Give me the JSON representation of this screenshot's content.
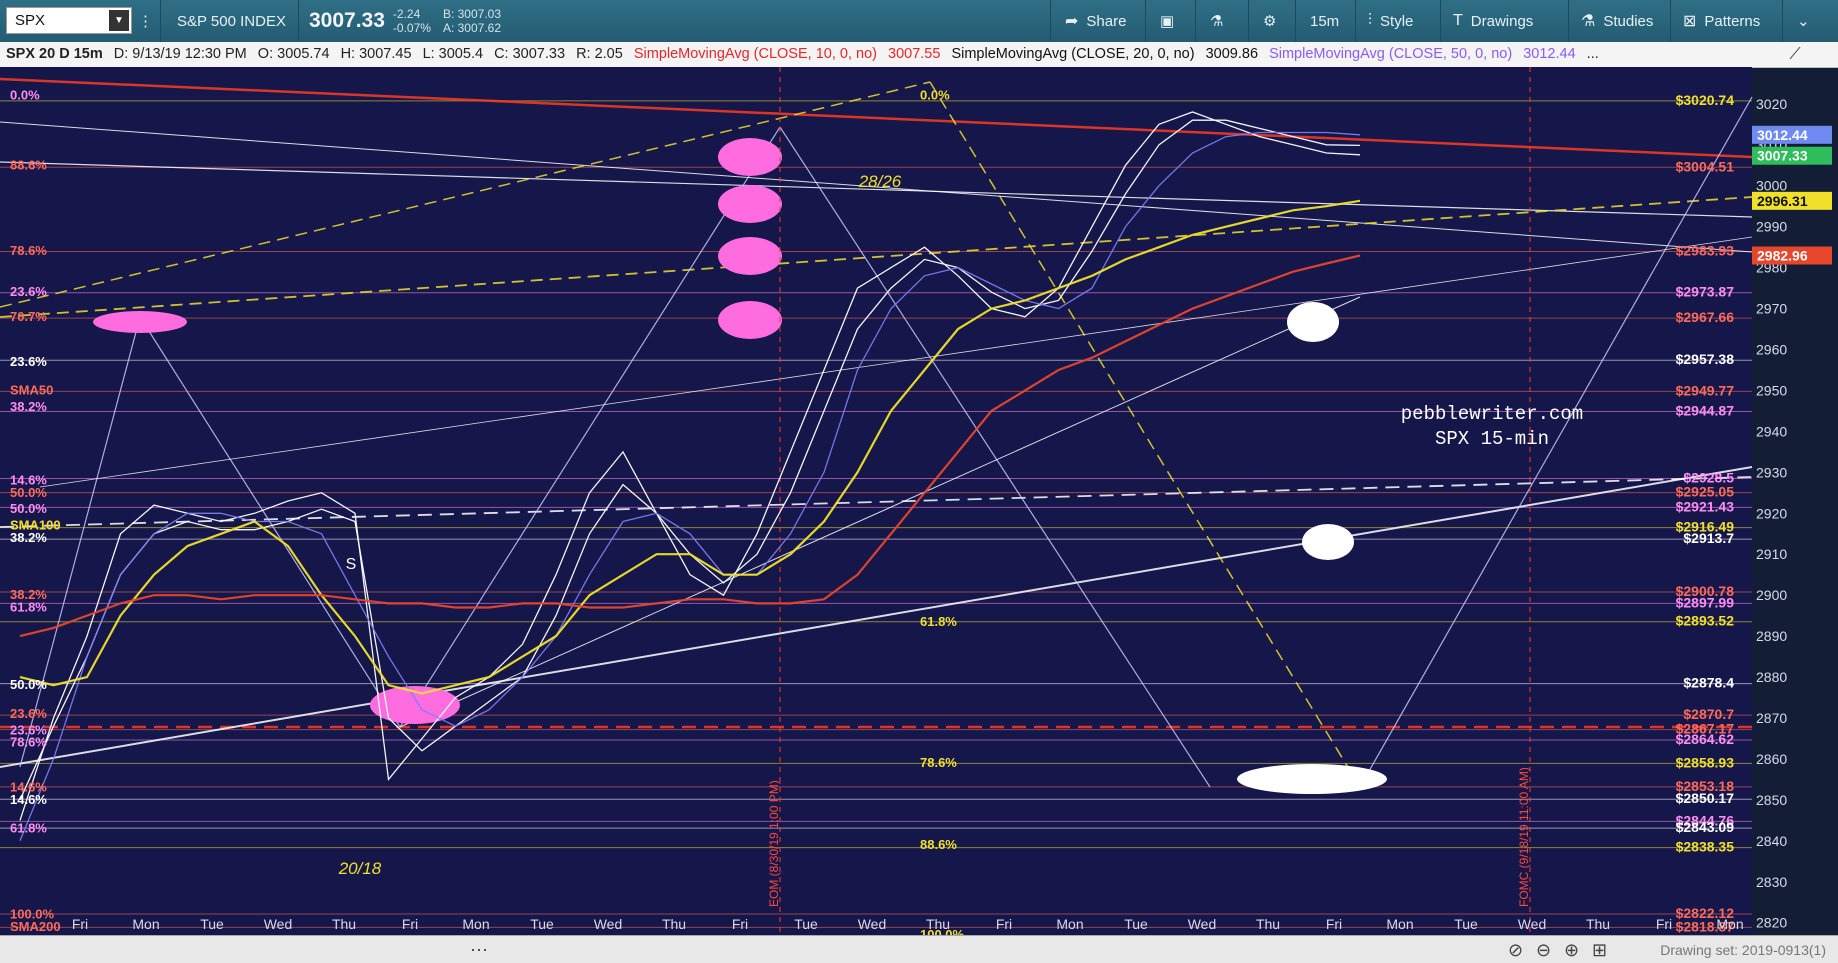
{
  "toolbar": {
    "symbol": "SPX",
    "index_name": "S&P 500 INDEX",
    "price": "3007.33",
    "change": "-2.24",
    "change_pct": "-0.07%",
    "bid": "B: 3007.03",
    "ask": "A: 3007.62",
    "share": "Share",
    "interval": "15m",
    "style": "Style",
    "drawings": "Drawings",
    "studies": "Studies",
    "patterns": "Patterns"
  },
  "infobar": {
    "title": "SPX 20 D 15m",
    "date": "D: 9/13/19 12:30 PM",
    "open": "O: 3005.74",
    "high": "H: 3007.45",
    "low": "L: 3005.4",
    "close": "C: 3007.33",
    "range": "R: 2.05",
    "sma10_label": "SimpleMovingAvg (CLOSE, 10, 0, no)",
    "sma10_value": "3007.55",
    "sma20_label": "SimpleMovingAvg (CLOSE, 20, 0, no)",
    "sma20_value": "3009.86",
    "sma50_label": "SimpleMovingAvg (CLOSE, 50, 0, no)",
    "sma50_value": "3012.44",
    "more": "..."
  },
  "footer": {
    "drawing_set": "Drawing set: 2019-0913(1)"
  },
  "chart_data": {
    "type": "line",
    "title": "SPX 20 D 15m",
    "ylim": [
      2817,
      3029
    ],
    "y_ticks": [
      3020,
      3010,
      3000,
      2990,
      2980,
      2970,
      2960,
      2950,
      2940,
      2930,
      2920,
      2910,
      2900,
      2890,
      2880,
      2870,
      2860,
      2850,
      2840,
      2830,
      2820
    ],
    "x_days": [
      "Fri",
      "Mon",
      "Tue",
      "Wed",
      "Thu",
      "Fri",
      "Mon",
      "Tue",
      "Wed",
      "Thu",
      "Fri",
      "Tue",
      "Wed",
      "Thu",
      "Fri",
      "Mon",
      "Tue",
      "Wed",
      "Thu",
      "Fri",
      "Mon",
      "Tue",
      "Wed",
      "Thu",
      "Fri",
      "Mon"
    ],
    "price_tags": [
      {
        "label": "3012.44",
        "value": 3012.44,
        "color": "#6f8bf2"
      },
      {
        "label": "3007.33",
        "value": 3007.33,
        "color": "#2ebd5a"
      },
      {
        "label": "2996.31",
        "value": 2996.31,
        "color": "#f0e02a"
      },
      {
        "label": "2982.96",
        "value": 2982.96,
        "color": "#e8462a"
      }
    ],
    "series": [
      {
        "name": "SimpleMovingAvg (CLOSE, 10, 0, no)",
        "color": "#ffffff",
        "x": [
          0,
          1,
          2,
          3,
          4,
          5,
          6,
          7,
          8,
          9,
          10,
          11,
          12,
          13,
          14,
          15,
          16,
          17,
          18,
          19,
          20,
          21,
          22,
          23,
          24,
          25,
          26,
          27,
          28,
          29,
          30,
          31,
          32,
          33,
          34,
          35,
          36,
          37,
          38,
          39,
          40
        ],
        "values": [
          2845,
          2870,
          2890,
          2915,
          2922,
          2920,
          2918,
          2920,
          2923,
          2925,
          2920,
          2855,
          2865,
          2875,
          2880,
          2888,
          2905,
          2925,
          2935,
          2920,
          2905,
          2900,
          2915,
          2935,
          2955,
          2975,
          2980,
          2985,
          2978,
          2970,
          2968,
          2975,
          2990,
          3005,
          3015,
          3018,
          3015,
          3012,
          3010,
          3008,
          3007.55
        ]
      },
      {
        "name": "SimpleMovingAvg (CLOSE, 20, 0, no)",
        "color": "#ffffff",
        "x": [
          0,
          1,
          2,
          3,
          4,
          5,
          6,
          7,
          8,
          9,
          10,
          11,
          12,
          13,
          14,
          15,
          16,
          17,
          18,
          19,
          20,
          21,
          22,
          23,
          24,
          25,
          26,
          27,
          28,
          29,
          30,
          31,
          32,
          33,
          34,
          35,
          36,
          37,
          38,
          39,
          40
        ],
        "values": [
          2850,
          2868,
          2885,
          2905,
          2915,
          2918,
          2916,
          2916,
          2918,
          2921,
          2918,
          2870,
          2862,
          2868,
          2874,
          2880,
          2895,
          2915,
          2927,
          2920,
          2910,
          2903,
          2910,
          2925,
          2945,
          2965,
          2975,
          2982,
          2980,
          2974,
          2970,
          2972,
          2984,
          2998,
          3010,
          3016,
          3016,
          3014,
          3012,
          3010,
          3009.86
        ]
      },
      {
        "name": "SimpleMovingAvg (CLOSE, 50, 0, no)",
        "color": "#7b7cf0",
        "x": [
          0,
          1,
          2,
          3,
          4,
          5,
          6,
          7,
          8,
          9,
          10,
          11,
          12,
          13,
          14,
          15,
          16,
          17,
          18,
          19,
          20,
          21,
          22,
          23,
          24,
          25,
          26,
          27,
          28,
          29,
          30,
          31,
          32,
          33,
          34,
          35,
          36,
          37,
          38,
          39,
          40
        ],
        "values": [
          2840,
          2860,
          2885,
          2905,
          2915,
          2920,
          2920,
          2918,
          2918,
          2915,
          2900,
          2885,
          2872,
          2868,
          2872,
          2880,
          2890,
          2905,
          2918,
          2920,
          2915,
          2905,
          2905,
          2915,
          2930,
          2955,
          2970,
          2978,
          2980,
          2976,
          2972,
          2970,
          2975,
          2990,
          3000,
          3008,
          3012,
          3013,
          3013,
          3013,
          3012.44
        ]
      },
      {
        "name": "SMA100",
        "color": "#f0e02a",
        "x": [
          0,
          1,
          2,
          3,
          4,
          5,
          6,
          7,
          8,
          9,
          10,
          11,
          12,
          13,
          14,
          15,
          16,
          17,
          18,
          19,
          20,
          21,
          22,
          23,
          24,
          25,
          26,
          27,
          28,
          29,
          30,
          31,
          32,
          33,
          34,
          35,
          36,
          37,
          38,
          39,
          40
        ],
        "values": [
          2880,
          2878,
          2880,
          2895,
          2905,
          2912,
          2915,
          2918,
          2912,
          2900,
          2890,
          2878,
          2876,
          2878,
          2880,
          2885,
          2890,
          2900,
          2905,
          2910,
          2910,
          2905,
          2905,
          2910,
          2918,
          2930,
          2945,
          2955,
          2965,
          2970,
          2972,
          2975,
          2978,
          2982,
          2985,
          2988,
          2990,
          2992,
          2994,
          2995,
          2996.31
        ]
      },
      {
        "name": "SMA200",
        "color": "#e8462a",
        "x": [
          0,
          1,
          2,
          3,
          4,
          5,
          6,
          7,
          8,
          9,
          10,
          11,
          12,
          13,
          14,
          15,
          16,
          17,
          18,
          19,
          20,
          21,
          22,
          23,
          24,
          25,
          26,
          27,
          28,
          29,
          30,
          31,
          32,
          33,
          34,
          35,
          36,
          37,
          38,
          39,
          40
        ],
        "values": [
          2890,
          2892,
          2895,
          2898,
          2900,
          2900,
          2899,
          2900,
          2900,
          2900,
          2899,
          2898,
          2898,
          2897,
          2897,
          2898,
          2898,
          2897,
          2897,
          2898,
          2899,
          2899,
          2898,
          2898,
          2899,
          2905,
          2915,
          2925,
          2935,
          2945,
          2950,
          2955,
          2958,
          2962,
          2966,
          2970,
          2973,
          2976,
          2979,
          2981,
          2982.96
        ]
      }
    ],
    "fib_labels_left": [
      {
        "text": "0.0%",
        "value": 3022,
        "color": "#ff8cf0"
      },
      {
        "text": "88.6%",
        "value": 3005,
        "color": "#ff6a5a"
      },
      {
        "text": "78.6%",
        "value": 2984,
        "color": "#ff6a5a"
      },
      {
        "text": "23.6%",
        "value": 2974,
        "color": "#ff8cf0"
      },
      {
        "text": "70.7%",
        "value": 2968,
        "color": "#ff6a5a"
      },
      {
        "text": "23.6%",
        "value": 2957,
        "color": "#ffffff"
      },
      {
        "text": "SMA50",
        "value": 2950,
        "color": "#ff6a5a"
      },
      {
        "text": "38.2%",
        "value": 2946,
        "color": "#ff8cf0"
      },
      {
        "text": "14.6%",
        "value": 2928,
        "color": "#ff8cf0"
      },
      {
        "text": "50.0%",
        "value": 2925,
        "color": "#ff6a5a"
      },
      {
        "text": "50.0%",
        "value": 2921,
        "color": "#ff8cf0"
      },
      {
        "text": "SMA100",
        "value": 2917,
        "color": "#f0e02a"
      },
      {
        "text": "38.2%",
        "value": 2914,
        "color": "#ffffff"
      },
      {
        "text": "38.2%",
        "value": 2900,
        "color": "#ff6a5a"
      },
      {
        "text": "61.8%",
        "value": 2897,
        "color": "#ff8cf0"
      },
      {
        "text": "50.0%",
        "value": 2878,
        "color": "#ffffff"
      },
      {
        "text": "23.6%",
        "value": 2871,
        "color": "#ff6a5a"
      },
      {
        "text": "23.6%",
        "value": 2867,
        "color": "#ff8cf0"
      },
      {
        "text": "78.6%",
        "value": 2864,
        "color": "#ff8cf0"
      },
      {
        "text": "14.6%",
        "value": 2853,
        "color": "#ff6a5a"
      },
      {
        "text": "14.6%",
        "value": 2850,
        "color": "#ffffff"
      },
      {
        "text": "61.8%",
        "value": 2843,
        "color": "#ff8cf0"
      },
      {
        "text": "100.0%",
        "value": 2822,
        "color": "#ff6a5a"
      },
      {
        "text": "SMA200",
        "value": 2819,
        "color": "#ff6a5a"
      }
    ],
    "fib_labels_mid": [
      {
        "text": "0.0%",
        "value": 3022,
        "color": "#f0e02a"
      },
      {
        "text": "61.8%",
        "value": 2893.5,
        "color": "#f0e02a"
      },
      {
        "text": "78.6%",
        "value": 2859,
        "color": "#f0e02a"
      },
      {
        "text": "88.6%",
        "value": 2839,
        "color": "#f0e02a"
      },
      {
        "text": "100.0%",
        "value": 2817,
        "color": "#f0e02a"
      }
    ],
    "level_labels_right": [
      {
        "text": "$3020.74",
        "value": 3020.74,
        "color": "#f0e02a"
      },
      {
        "text": "$3004.51",
        "value": 3004.51,
        "color": "#ff6a5a"
      },
      {
        "text": "$2983.93",
        "value": 2983.93,
        "color": "#ff6a5a"
      },
      {
        "text": "$2973.87",
        "value": 2973.87,
        "color": "#ff8cf0"
      },
      {
        "text": "$2967.66",
        "value": 2967.66,
        "color": "#ff6a5a"
      },
      {
        "text": "$2957.38",
        "value": 2957.38,
        "color": "#ffffff"
      },
      {
        "text": "$2949.77",
        "value": 2949.77,
        "color": "#ff6a5a"
      },
      {
        "text": "$2944.87",
        "value": 2944.87,
        "color": "#ff8cf0"
      },
      {
        "text": "$2928.5",
        "value": 2928.5,
        "color": "#ff8cf0"
      },
      {
        "text": "$2925.05",
        "value": 2925.05,
        "color": "#ff6a5a"
      },
      {
        "text": "$2921.43",
        "value": 2921.43,
        "color": "#ff8cf0"
      },
      {
        "text": "$2916.49",
        "value": 2916.49,
        "color": "#f0e02a"
      },
      {
        "text": "$2913.7",
        "value": 2913.7,
        "color": "#ffffff"
      },
      {
        "text": "$2900.78",
        "value": 2900.78,
        "color": "#ff6a5a"
      },
      {
        "text": "$2897.99",
        "value": 2897.99,
        "color": "#ff8cf0"
      },
      {
        "text": "$2893.52",
        "value": 2893.52,
        "color": "#f0e02a"
      },
      {
        "text": "$2878.4",
        "value": 2878.4,
        "color": "#ffffff"
      },
      {
        "text": "$2870.7",
        "value": 2870.7,
        "color": "#ff6a5a"
      },
      {
        "text": "$2867.17",
        "value": 2867.17,
        "color": "#ff6a5a"
      },
      {
        "text": "$2864.62",
        "value": 2864.62,
        "color": "#ff8cf0"
      },
      {
        "text": "$2858.93",
        "value": 2858.93,
        "color": "#f0e02a"
      },
      {
        "text": "$2853.18",
        "value": 2853.18,
        "color": "#ff6a5a"
      },
      {
        "text": "$2850.17",
        "value": 2850.17,
        "color": "#ffffff"
      },
      {
        "text": "$2844.76",
        "value": 2844.76,
        "color": "#ff8cf0"
      },
      {
        "text": "$2843.09",
        "value": 2843.09,
        "color": "#ffffff"
      },
      {
        "text": "$2838.35",
        "value": 2838.35,
        "color": "#f0e02a"
      },
      {
        "text": "$2822.12",
        "value": 2822.12,
        "color": "#ff6a5a"
      },
      {
        "text": "$2818.87",
        "value": 2818.87,
        "color": "#ff6a5a"
      }
    ],
    "annotations": [
      {
        "text": "pebblewriter.com",
        "color": "#ffffff"
      },
      {
        "text": "SPX 15-min",
        "color": "#ffffff"
      },
      {
        "text": "28/26",
        "color": "#f0e02a"
      },
      {
        "text": "20/18",
        "color": "#f0e02a"
      },
      {
        "text": "S",
        "color": "#ffffff"
      },
      {
        "text": "EOM (8/30/19 1:00 PM)",
        "color": "#ff4a3a"
      },
      {
        "text": "FOMC (9/18/19 11:00 AM)",
        "color": "#ff4a3a"
      }
    ]
  }
}
